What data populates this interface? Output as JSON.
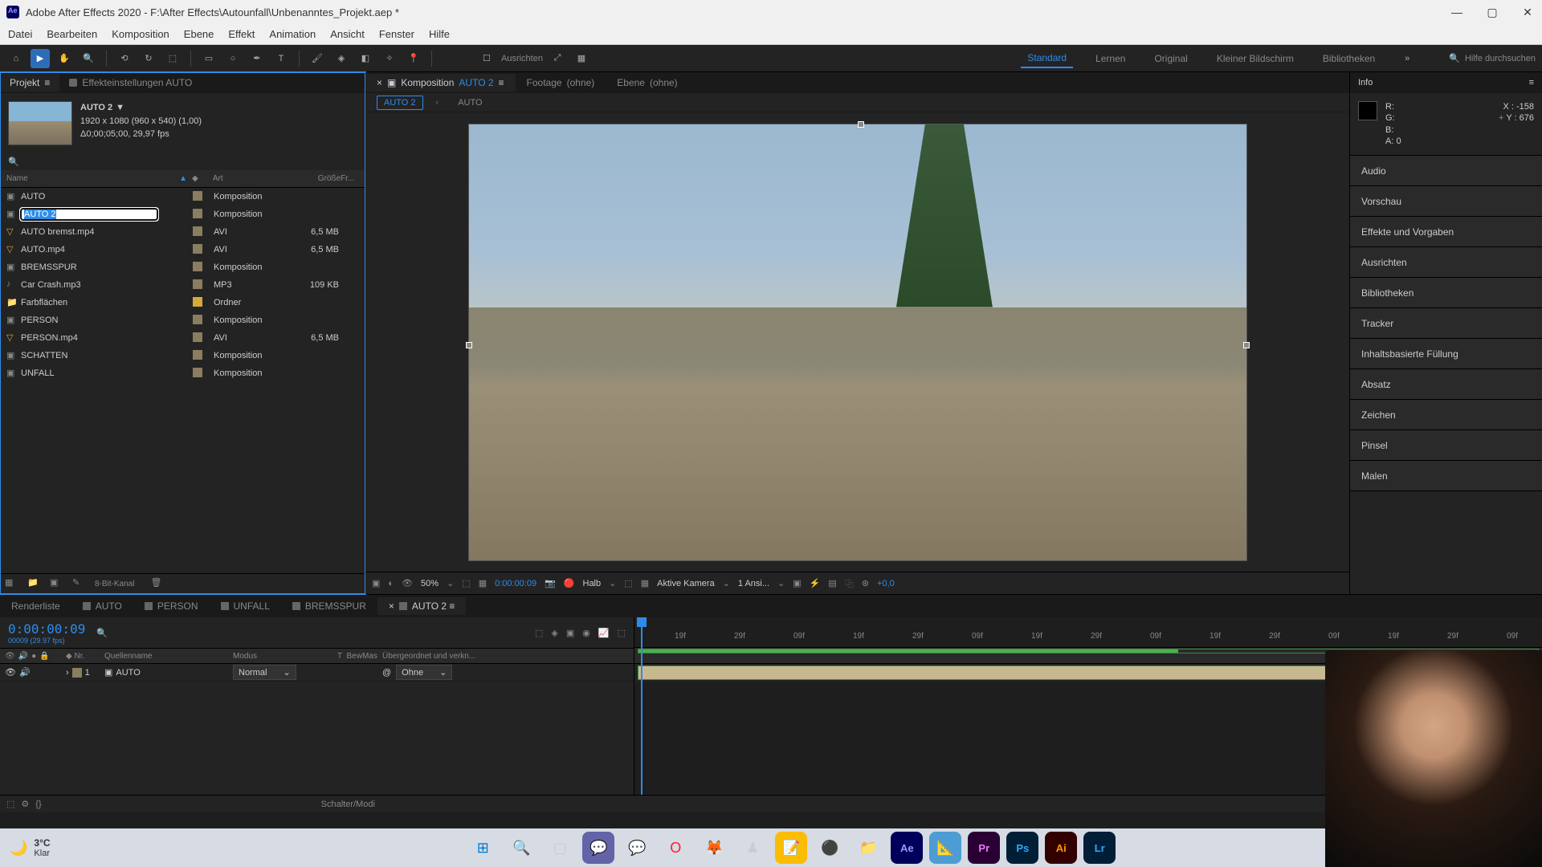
{
  "window": {
    "title": "Adobe After Effects 2020 - F:\\After Effects\\Autounfall\\Unbenanntes_Projekt.aep *"
  },
  "menu": [
    "Datei",
    "Bearbeiten",
    "Komposition",
    "Ebene",
    "Effekt",
    "Animation",
    "Ansicht",
    "Fenster",
    "Hilfe"
  ],
  "toolbar": {
    "ausrichten": "Ausrichten"
  },
  "workspaces": [
    "Standard",
    "Lernen",
    "Original",
    "Kleiner Bildschirm",
    "Bibliotheken"
  ],
  "search_placeholder": "Hilfe durchsuchen",
  "project": {
    "tab_project": "Projekt",
    "tab_effects": "Effekteinstellungen AUTO",
    "comp_name": "AUTO 2",
    "comp_res": "1920 x 1080 (960 x 540) (1,00)",
    "comp_dur": "Δ0;00;05;00, 29,97 fps",
    "header": {
      "name": "Name",
      "art": "Art",
      "grosse": "Größe",
      "fr": "Fr..."
    },
    "items": [
      {
        "name": "AUTO",
        "type": "Komposition",
        "size": "",
        "icon": "comp",
        "label": "#8a7d60"
      },
      {
        "name": "AUTO 2",
        "type": "Komposition",
        "size": "",
        "icon": "comp",
        "label": "#8a7d60",
        "editing": true
      },
      {
        "name": "AUTO bremst.mp4",
        "type": "AVI",
        "size": "6,5 MB",
        "icon": "video",
        "label": "#8a7d60"
      },
      {
        "name": "AUTO.mp4",
        "type": "AVI",
        "size": "6,5 MB",
        "icon": "video",
        "label": "#8a7d60"
      },
      {
        "name": "BREMSSPUR",
        "type": "Komposition",
        "size": "",
        "icon": "comp",
        "label": "#8a7d60"
      },
      {
        "name": "Car Crash.mp3",
        "type": "MP3",
        "size": "109 KB",
        "icon": "audio",
        "label": "#8a7d60"
      },
      {
        "name": "Farbflächen",
        "type": "Ordner",
        "size": "",
        "icon": "folder",
        "label": "#d4a938"
      },
      {
        "name": "PERSON",
        "type": "Komposition",
        "size": "",
        "icon": "comp",
        "label": "#8a7d60"
      },
      {
        "name": "PERSON.mp4",
        "type": "AVI",
        "size": "6,5 MB",
        "icon": "video",
        "label": "#8a7d60"
      },
      {
        "name": "SCHATTEN",
        "type": "Komposition",
        "size": "",
        "icon": "comp",
        "label": "#8a7d60"
      },
      {
        "name": "UNFALL",
        "type": "Komposition",
        "size": "",
        "icon": "comp",
        "label": "#8a7d60"
      }
    ],
    "footer_bit": "8-Bit-Kanal"
  },
  "comp_panel": {
    "tab_comp": "Komposition",
    "tab_comp_name": "AUTO 2",
    "tab_footage": "Footage",
    "tab_footage_val": "(ohne)",
    "tab_ebene": "Ebene",
    "tab_ebene_val": "(ohne)",
    "sub_active": "AUTO 2",
    "sub_parent": "AUTO"
  },
  "viewer": {
    "zoom": "50%",
    "time": "0:00:00:09",
    "res": "Halb",
    "camera": "Aktive Kamera",
    "views": "1 Ansi...",
    "exposure": "+0,0"
  },
  "info": {
    "title": "Info",
    "r": "R:",
    "g": "G:",
    "b": "B:",
    "a": "A:",
    "a_val": "0",
    "x": "X : -158",
    "y": "Y : 676"
  },
  "side_panels": [
    "Audio",
    "Vorschau",
    "Effekte und Vorgaben",
    "Ausrichten",
    "Bibliotheken",
    "Tracker",
    "Inhaltsbasierte Füllung",
    "Absatz",
    "Zeichen",
    "Pinsel",
    "Malen"
  ],
  "timeline": {
    "tabs": [
      "Renderliste",
      "AUTO",
      "PERSON",
      "UNFALL",
      "BREMSSPUR",
      "AUTO 2"
    ],
    "active_tab": "AUTO 2",
    "timecode": "0:00:00:09",
    "sub_time": "00009 (29.97 fps)",
    "header": {
      "nr": "Nr.",
      "quelle": "Quellenname",
      "modus": "Modus",
      "t": "T",
      "bewmas": "BewMas",
      "parent": "Übergeordnet und verkn..."
    },
    "layers": [
      {
        "nr": "1",
        "name": "AUTO",
        "mode": "Normal",
        "parent": "Ohne",
        "label": "#8a7d60"
      }
    ],
    "ruler_ticks": [
      "19f",
      "29f",
      "09f",
      "19f",
      "29f",
      "09f",
      "19f",
      "29f",
      "09f",
      "19f",
      "29f",
      "09f",
      "19f",
      "29f",
      "09f"
    ],
    "footer": "Schalter/Modi"
  },
  "taskbar": {
    "temp": "3°C",
    "condition": "Klar"
  }
}
